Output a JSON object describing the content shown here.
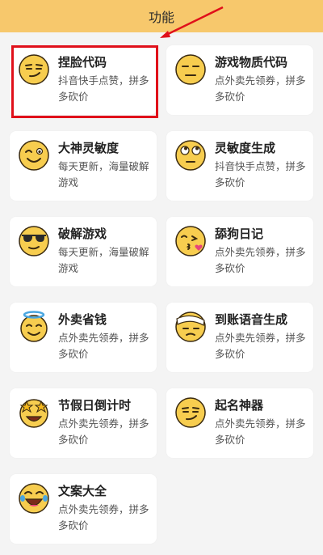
{
  "header": {
    "title": "功能"
  },
  "colors": {
    "header_bg": "#f7c86c",
    "highlight": "#e0101a",
    "emoji": "#f7cd4f"
  },
  "cards": [
    {
      "title": "捏脸代码",
      "desc": "抖音快手点赞，拼多多砍价",
      "icon": "smirk-face-icon"
    },
    {
      "title": "游戏物质代码",
      "desc": "点外卖先领券，拼多多砍价",
      "icon": "neutral-face-icon"
    },
    {
      "title": "大神灵敏度",
      "desc": "每天更新，海量破解游戏",
      "icon": "wink-face-icon"
    },
    {
      "title": "灵敏度生成",
      "desc": "抖音快手点赞，拼多多砍价",
      "icon": "eye-roll-face-icon"
    },
    {
      "title": "破解游戏",
      "desc": "每天更新，海量破解游戏",
      "icon": "sunglasses-face-icon"
    },
    {
      "title": "舔狗日记",
      "desc": "点外卖先领券，拼多多砍价",
      "icon": "kiss-face-icon"
    },
    {
      "title": "外卖省钱",
      "desc": "点外卖先领券，拼多多砍价",
      "icon": "halo-face-icon"
    },
    {
      "title": "到账语音生成",
      "desc": "点外卖先领券，拼多多砍价",
      "icon": "bandage-face-icon"
    },
    {
      "title": "节假日倒计时",
      "desc": "点外卖先领券，拼多多砍价",
      "icon": "star-struck-face-icon"
    },
    {
      "title": "起名神器",
      "desc": "点外卖先领券，拼多多砍价",
      "icon": "smirk-face-icon"
    },
    {
      "title": "文案大全",
      "desc": "点外卖先领券，拼多多砍价",
      "icon": "laugh-tears-face-icon"
    }
  ]
}
